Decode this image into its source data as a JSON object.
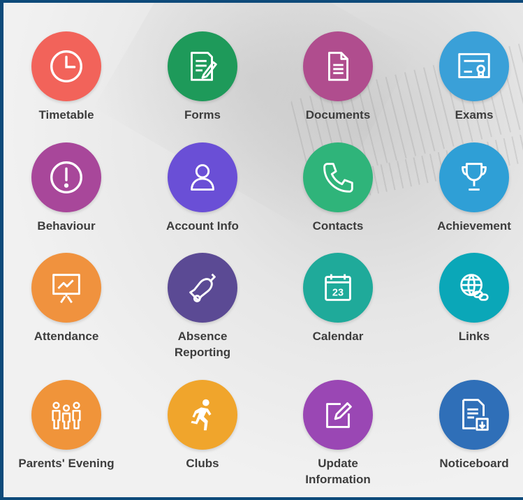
{
  "tiles": [
    {
      "label": "Timetable",
      "icon": "clock-icon",
      "color": "#f2635a"
    },
    {
      "label": "Forms",
      "icon": "form-icon",
      "color": "#1e9a5a"
    },
    {
      "label": "Documents",
      "icon": "document-icon",
      "color": "#b04d8e"
    },
    {
      "label": "Exams",
      "icon": "certificate-icon",
      "color": "#3aa0d8"
    },
    {
      "label": "Behaviour",
      "icon": "exclamation-icon",
      "color": "#a8479a"
    },
    {
      "label": "Account Info",
      "icon": "user-icon",
      "color": "#6a4fd6"
    },
    {
      "label": "Contacts",
      "icon": "phone-icon",
      "color": "#2fb47a"
    },
    {
      "label": "Achievement",
      "icon": "trophy-icon",
      "color": "#2f9fd6"
    },
    {
      "label": "Attendance",
      "icon": "presentation-chart-icon",
      "color": "#f0923e"
    },
    {
      "label": "Absence\nReporting",
      "icon": "bell-icon",
      "color": "#5b4a94"
    },
    {
      "label": "Calendar",
      "icon": "calendar-icon",
      "color": "#1faa9a"
    },
    {
      "label": "Links",
      "icon": "globe-link-icon",
      "color": "#0aa7b8"
    },
    {
      "label": "Parents' Evening",
      "icon": "people-icon",
      "color": "#f0943a"
    },
    {
      "label": "Clubs",
      "icon": "running-person-icon",
      "color": "#f0a52c"
    },
    {
      "label": "Update\nInformation",
      "icon": "edit-icon",
      "color": "#9a47b4"
    },
    {
      "label": "Noticeboard",
      "icon": "noticeboard-icon",
      "color": "#2f6fb8"
    }
  ],
  "calendar_day": "23"
}
